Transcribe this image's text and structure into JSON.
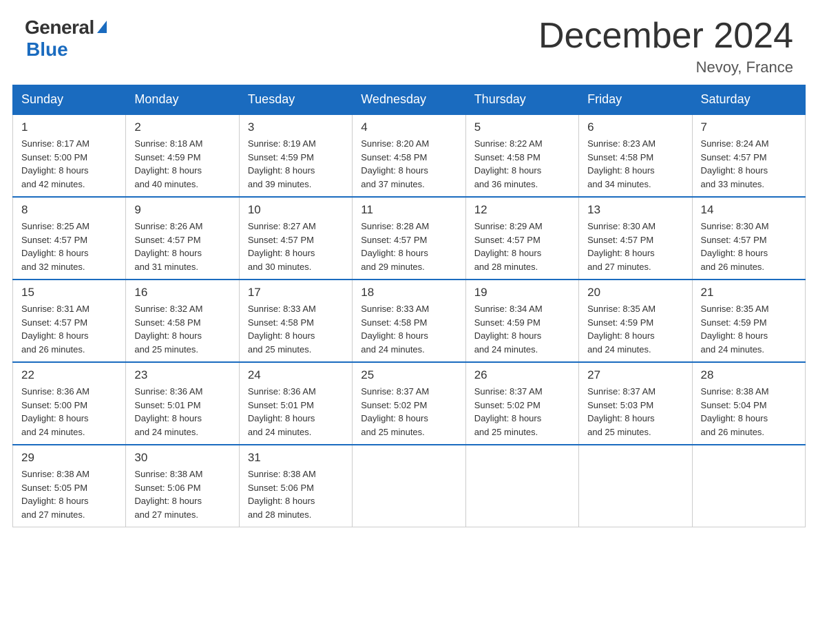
{
  "logo": {
    "general": "General",
    "blue": "Blue"
  },
  "title": "December 2024",
  "location": "Nevoy, France",
  "weekdays": [
    "Sunday",
    "Monday",
    "Tuesday",
    "Wednesday",
    "Thursday",
    "Friday",
    "Saturday"
  ],
  "weeks": [
    [
      {
        "day": "1",
        "info": "Sunrise: 8:17 AM\nSunset: 5:00 PM\nDaylight: 8 hours\nand 42 minutes."
      },
      {
        "day": "2",
        "info": "Sunrise: 8:18 AM\nSunset: 4:59 PM\nDaylight: 8 hours\nand 40 minutes."
      },
      {
        "day": "3",
        "info": "Sunrise: 8:19 AM\nSunset: 4:59 PM\nDaylight: 8 hours\nand 39 minutes."
      },
      {
        "day": "4",
        "info": "Sunrise: 8:20 AM\nSunset: 4:58 PM\nDaylight: 8 hours\nand 37 minutes."
      },
      {
        "day": "5",
        "info": "Sunrise: 8:22 AM\nSunset: 4:58 PM\nDaylight: 8 hours\nand 36 minutes."
      },
      {
        "day": "6",
        "info": "Sunrise: 8:23 AM\nSunset: 4:58 PM\nDaylight: 8 hours\nand 34 minutes."
      },
      {
        "day": "7",
        "info": "Sunrise: 8:24 AM\nSunset: 4:57 PM\nDaylight: 8 hours\nand 33 minutes."
      }
    ],
    [
      {
        "day": "8",
        "info": "Sunrise: 8:25 AM\nSunset: 4:57 PM\nDaylight: 8 hours\nand 32 minutes."
      },
      {
        "day": "9",
        "info": "Sunrise: 8:26 AM\nSunset: 4:57 PM\nDaylight: 8 hours\nand 31 minutes."
      },
      {
        "day": "10",
        "info": "Sunrise: 8:27 AM\nSunset: 4:57 PM\nDaylight: 8 hours\nand 30 minutes."
      },
      {
        "day": "11",
        "info": "Sunrise: 8:28 AM\nSunset: 4:57 PM\nDaylight: 8 hours\nand 29 minutes."
      },
      {
        "day": "12",
        "info": "Sunrise: 8:29 AM\nSunset: 4:57 PM\nDaylight: 8 hours\nand 28 minutes."
      },
      {
        "day": "13",
        "info": "Sunrise: 8:30 AM\nSunset: 4:57 PM\nDaylight: 8 hours\nand 27 minutes."
      },
      {
        "day": "14",
        "info": "Sunrise: 8:30 AM\nSunset: 4:57 PM\nDaylight: 8 hours\nand 26 minutes."
      }
    ],
    [
      {
        "day": "15",
        "info": "Sunrise: 8:31 AM\nSunset: 4:57 PM\nDaylight: 8 hours\nand 26 minutes."
      },
      {
        "day": "16",
        "info": "Sunrise: 8:32 AM\nSunset: 4:58 PM\nDaylight: 8 hours\nand 25 minutes."
      },
      {
        "day": "17",
        "info": "Sunrise: 8:33 AM\nSunset: 4:58 PM\nDaylight: 8 hours\nand 25 minutes."
      },
      {
        "day": "18",
        "info": "Sunrise: 8:33 AM\nSunset: 4:58 PM\nDaylight: 8 hours\nand 24 minutes."
      },
      {
        "day": "19",
        "info": "Sunrise: 8:34 AM\nSunset: 4:59 PM\nDaylight: 8 hours\nand 24 minutes."
      },
      {
        "day": "20",
        "info": "Sunrise: 8:35 AM\nSunset: 4:59 PM\nDaylight: 8 hours\nand 24 minutes."
      },
      {
        "day": "21",
        "info": "Sunrise: 8:35 AM\nSunset: 4:59 PM\nDaylight: 8 hours\nand 24 minutes."
      }
    ],
    [
      {
        "day": "22",
        "info": "Sunrise: 8:36 AM\nSunset: 5:00 PM\nDaylight: 8 hours\nand 24 minutes."
      },
      {
        "day": "23",
        "info": "Sunrise: 8:36 AM\nSunset: 5:01 PM\nDaylight: 8 hours\nand 24 minutes."
      },
      {
        "day": "24",
        "info": "Sunrise: 8:36 AM\nSunset: 5:01 PM\nDaylight: 8 hours\nand 24 minutes."
      },
      {
        "day": "25",
        "info": "Sunrise: 8:37 AM\nSunset: 5:02 PM\nDaylight: 8 hours\nand 25 minutes."
      },
      {
        "day": "26",
        "info": "Sunrise: 8:37 AM\nSunset: 5:02 PM\nDaylight: 8 hours\nand 25 minutes."
      },
      {
        "day": "27",
        "info": "Sunrise: 8:37 AM\nSunset: 5:03 PM\nDaylight: 8 hours\nand 25 minutes."
      },
      {
        "day": "28",
        "info": "Sunrise: 8:38 AM\nSunset: 5:04 PM\nDaylight: 8 hours\nand 26 minutes."
      }
    ],
    [
      {
        "day": "29",
        "info": "Sunrise: 8:38 AM\nSunset: 5:05 PM\nDaylight: 8 hours\nand 27 minutes."
      },
      {
        "day": "30",
        "info": "Sunrise: 8:38 AM\nSunset: 5:06 PM\nDaylight: 8 hours\nand 27 minutes."
      },
      {
        "day": "31",
        "info": "Sunrise: 8:38 AM\nSunset: 5:06 PM\nDaylight: 8 hours\nand 28 minutes."
      },
      null,
      null,
      null,
      null
    ]
  ]
}
